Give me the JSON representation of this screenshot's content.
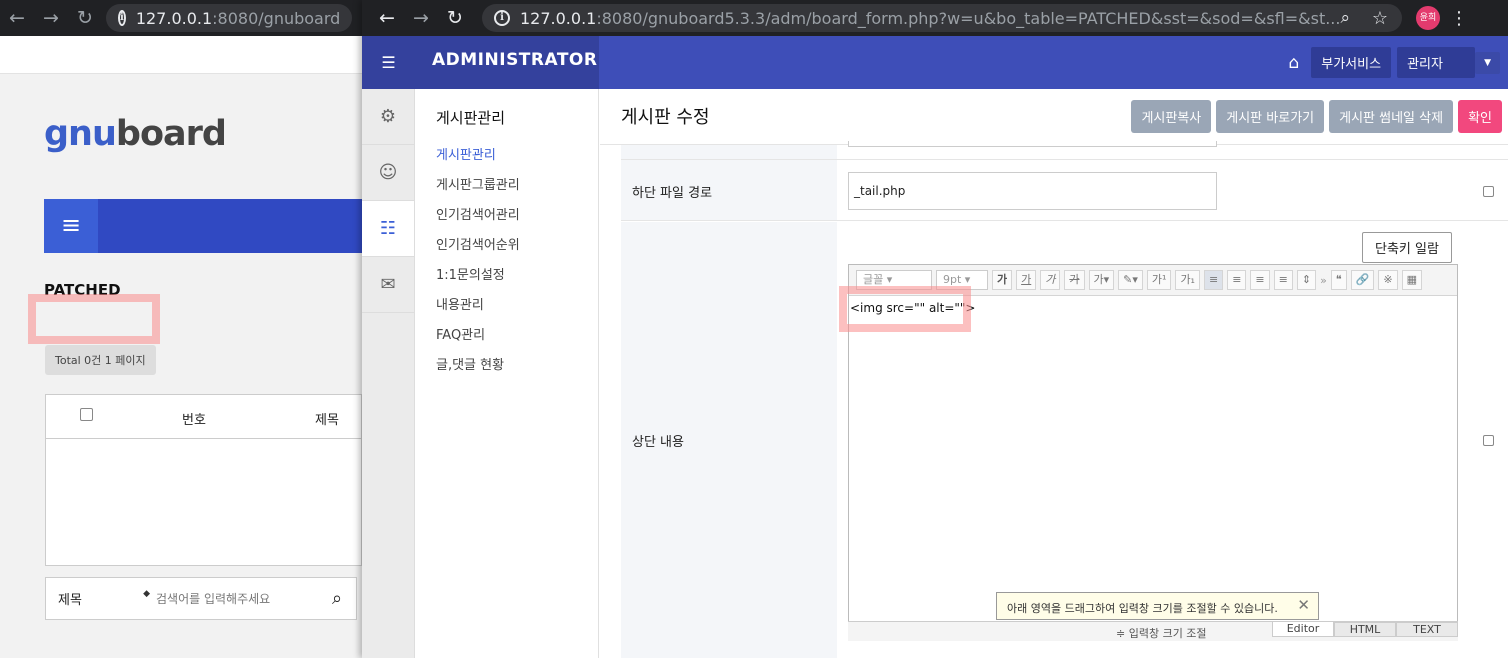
{
  "left_window": {
    "browser": {
      "url_host": "127.0.0.1",
      "url_rest": ":8080/gnuboard"
    },
    "logo": {
      "part1": "gnu",
      "part2": "board"
    },
    "board_title": "PATCHED",
    "total_badge": "Total 0건 1 페이지",
    "table_headers": {
      "number": "번호",
      "subject": "제목"
    },
    "search": {
      "select_value": "제목",
      "placeholder": "검색어를 입력해주세요"
    }
  },
  "right_window": {
    "browser": {
      "url_host": "127.0.0.1",
      "url_rest": ":8080/gnuboard5.3.3/adm/board_form.php?w=u&bo_table=PATCHED&sst=&sod=&sfl=&st..."
    },
    "header": {
      "title": "ADMINISTRATOR",
      "addon_services": "부가서비스",
      "admin_user": "관리자"
    },
    "submenu": {
      "heading": "게시판관리",
      "items": [
        "게시판관리",
        "게시판그룹관리",
        "인기검색어관리",
        "인기검색어순위",
        "1:1문의설정",
        "내용관리",
        "FAQ관리",
        "글,댓글 현황"
      ]
    },
    "page": {
      "title": "게시판 수정",
      "buttons": {
        "copy": "게시판복사",
        "go_board": "게시판 바로가기",
        "delete_thumbs": "게시판 썸네일 삭제",
        "confirm": "확인"
      }
    },
    "form": {
      "tail_file_label": "하단 파일 경로",
      "tail_file_value": "_tail.php",
      "head_content_label": "상단 내용",
      "shortcut_button": "단축키 일람",
      "editor": {
        "font_select": "글꼴",
        "size_select": "9pt",
        "content": "<img src=\"\" alt=\"\">",
        "tooltip": "아래 영역을 드래그하여 입력창 크기를 조절할 수 있습니다.",
        "resize_label": "≑ 입력창 크기 조절",
        "modes": [
          "Editor",
          "HTML",
          "TEXT"
        ]
      }
    }
  }
}
